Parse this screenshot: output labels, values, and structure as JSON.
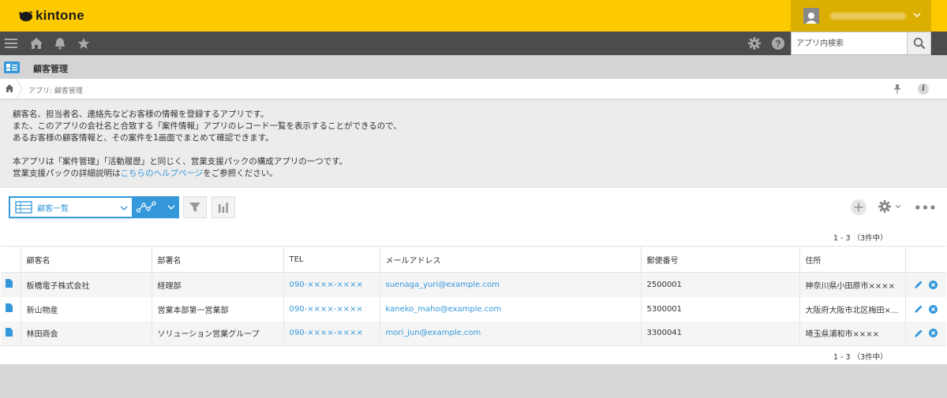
{
  "header": {
    "logo_text": "kintone",
    "brand_color": "#fdc900"
  },
  "navbar": {
    "search_placeholder": "アプリ内検索",
    "icons": [
      "menu-icon",
      "home-icon",
      "bell-icon",
      "star-icon",
      "gear-icon",
      "help-icon",
      "search-icon"
    ]
  },
  "app": {
    "title": "顧客管理"
  },
  "breadcrumb": {
    "text": "アプリ: 顧客管理"
  },
  "description": {
    "line1": "顧客名、担当者名、連絡先などお客様の情報を登録するアプリです。",
    "line2": "また、このアプリの会社名と合致する「案件情報」アプリのレコード一覧を表示することができるので、",
    "line3": "あるお客様の顧客情報と、その案件を1画面でまとめて確認できます。",
    "line4": "本アプリは「案件管理」「活動履歴」と同じく、営業支援パックの構成アプリの一つです。",
    "line5_prefix": "営業支援パックの詳細説明は",
    "line5_link": "こちらのヘルプページ",
    "line5_suffix": "をご参照ください。"
  },
  "toolbar": {
    "view_label": "顧客一覧"
  },
  "pager": {
    "top": "1 - 3 （3件中）",
    "bottom": "1 - 3 （3件中）"
  },
  "table": {
    "headers": {
      "name": "顧客名",
      "dept": "部署名",
      "tel": "TEL",
      "email": "メールアドレス",
      "zip": "郵便番号",
      "address": "住所"
    },
    "rows": [
      {
        "name": "板橋電子株式会社",
        "dept": "経理部",
        "tel": "090-××××-××××",
        "email": "suenaga_yuri@example.com",
        "zip": "2500001",
        "address": "神奈川県小田原市××××"
      },
      {
        "name": "新山物産",
        "dept": "営業本部第一営業部",
        "tel": "090-××××-××××",
        "email": "kaneko_maho@example.com",
        "zip": "5300001",
        "address": "大阪府大阪市北区梅田××-××-××"
      },
      {
        "name": "林田商会",
        "dept": "ソリューション営業グループ",
        "tel": "090-××××-××××",
        "email": "mori_jun@example.com",
        "zip": "3300041",
        "address": "埼玉県浦和市××××"
      }
    ]
  },
  "colors": {
    "accent": "#3498db",
    "navbar": "#4c4c4c",
    "delete": "#3498db"
  }
}
